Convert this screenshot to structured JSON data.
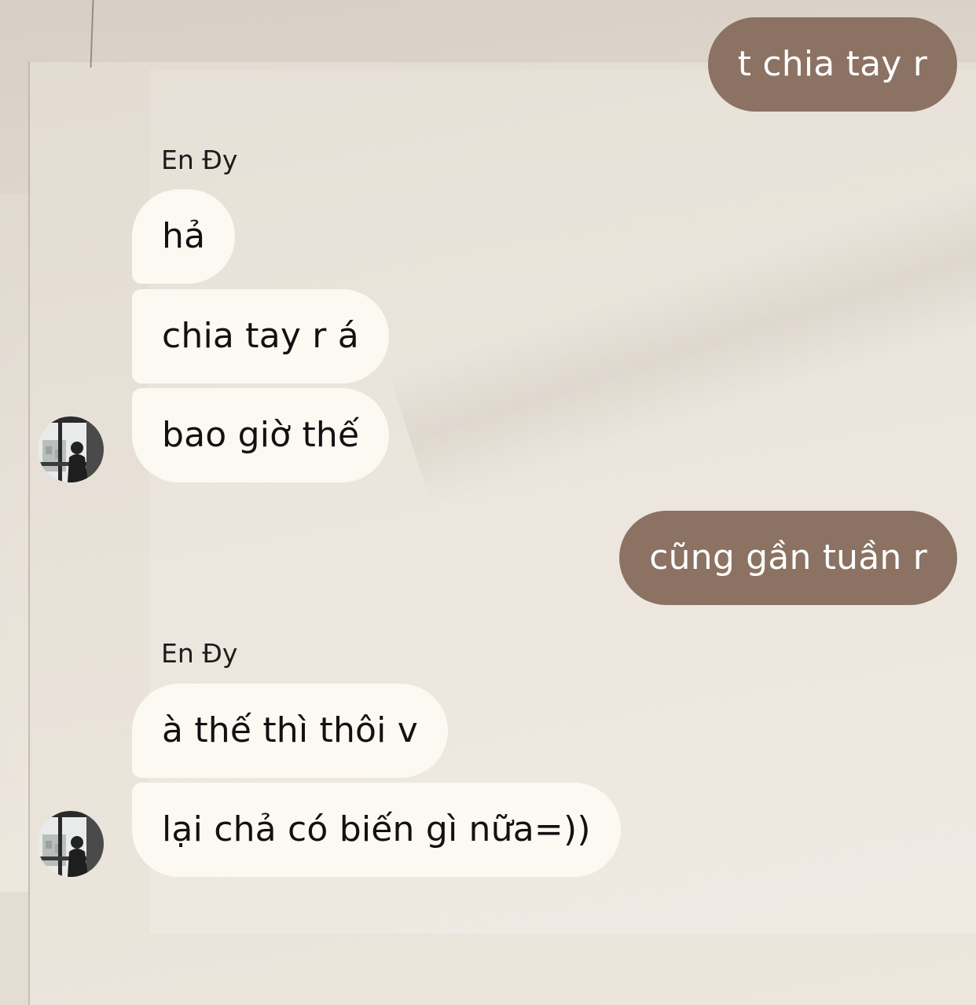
{
  "conversation": {
    "messages": [
      {
        "direction": "outgoing",
        "text": "t chia tay r"
      },
      {
        "direction": "incoming",
        "sender": "En Đy",
        "text": "hả"
      },
      {
        "direction": "incoming",
        "text": "chia tay r á"
      },
      {
        "direction": "incoming",
        "text": "bao giờ thế"
      },
      {
        "direction": "outgoing",
        "text": "cũng gần tuần r"
      },
      {
        "direction": "incoming",
        "sender": "En Đy",
        "text": "à thế thì thôi v"
      },
      {
        "direction": "incoming",
        "text": "lại chả có biến gì nữa=))"
      }
    ]
  },
  "colors": {
    "outgoing_bubble": "#8b7263",
    "incoming_bubble": "#fcf8f2",
    "background": "#e4ddd4"
  }
}
